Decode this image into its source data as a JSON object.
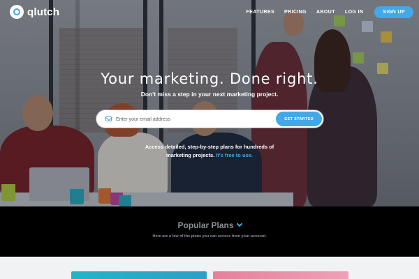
{
  "nav": {
    "brand": "qlutch",
    "links": [
      "FEATURES",
      "PRICING",
      "ABOUT",
      "LOG IN"
    ],
    "signup_label": "SIGN UP"
  },
  "hero": {
    "title": "Your marketing. Done right.",
    "subtitle": "Don't miss a step in your next marketing project.",
    "email_placeholder": "Enter your email address",
    "cta_label": "GET STARTED",
    "desc_line1": "Access detailed, step-by-step plans for hundreds of",
    "desc_line2": "marketing projects.",
    "desc_link": "It's free to use."
  },
  "plans": {
    "title": "Popular Plans",
    "subtitle": "Here are a few of the plans you can access from your account."
  },
  "colors": {
    "accent": "#42a9e6",
    "plans_bg": "#000000",
    "card_teal": "#24b5c8",
    "card_pink": "#e87f9b"
  },
  "icons": [
    "logo-icon",
    "mail-icon",
    "chevron-down-icon"
  ]
}
